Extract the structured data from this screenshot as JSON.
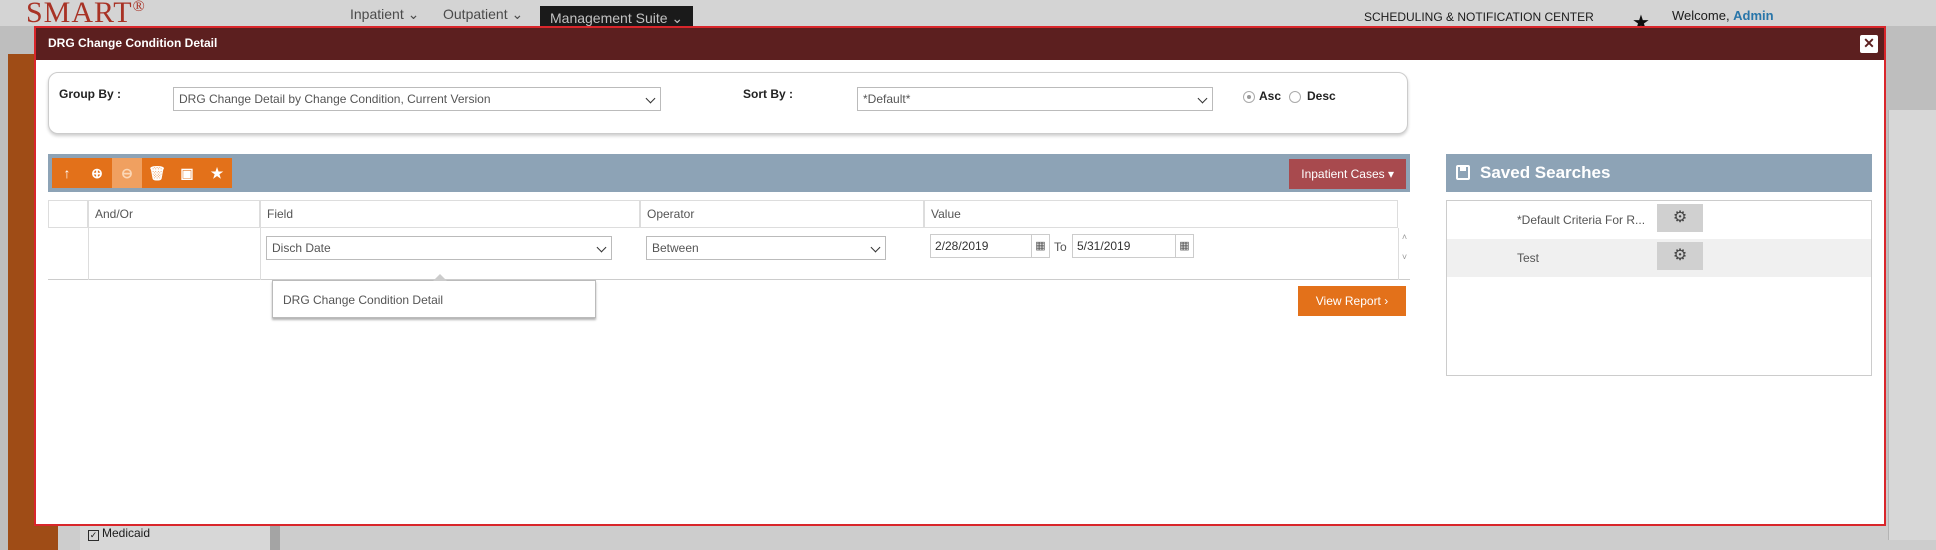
{
  "app": {
    "logo": "SMART",
    "logo_mark": "®",
    "nav": [
      "Inpatient ⌄",
      "Outpatient ⌄",
      "Management Suite ⌄"
    ],
    "scheduling": "SCHEDULING & NOTIFICATION CENTER",
    "welcome_prefix": "Welcome, ",
    "welcome_user": "Admin",
    "sidebar_item": "Medicaid"
  },
  "modal": {
    "title": "DRG Change Condition Detail",
    "close": "✕"
  },
  "group": {
    "group_by_label": "Group By :",
    "group_by_value": "DRG Change Detail by Change Condition, Current Version",
    "sort_by_label": "Sort By :",
    "sort_by_value": "*Default*",
    "asc_label": "Asc",
    "desc_label": "Desc",
    "selected_order": "Asc"
  },
  "toolbar": {
    "icons": [
      "arrow-up-icon",
      "add-circle-icon",
      "remove-circle-icon",
      "trash-icon",
      "save-icon",
      "star-icon"
    ],
    "case_button": "Inpatient Cases ▾"
  },
  "grid": {
    "headers": [
      "",
      "And/Or",
      "Field",
      "Operator",
      "Value"
    ],
    "row": {
      "field": "Disch Date",
      "operator": "Between",
      "value_from": "2/28/2019",
      "to_label": "To",
      "value_to": "5/31/2019"
    }
  },
  "popup": {
    "item": "DRG Change Condition Detail"
  },
  "view_report": "View Report ›",
  "saved": {
    "title": "Saved Searches",
    "items": [
      "*Default Criteria For R...",
      "Test"
    ]
  },
  "colors": {
    "modal_header": "#5c1f1f",
    "accent_orange": "#e3711a",
    "toolbar_blue": "#8da3b6",
    "case_button": "#a84a4e"
  }
}
